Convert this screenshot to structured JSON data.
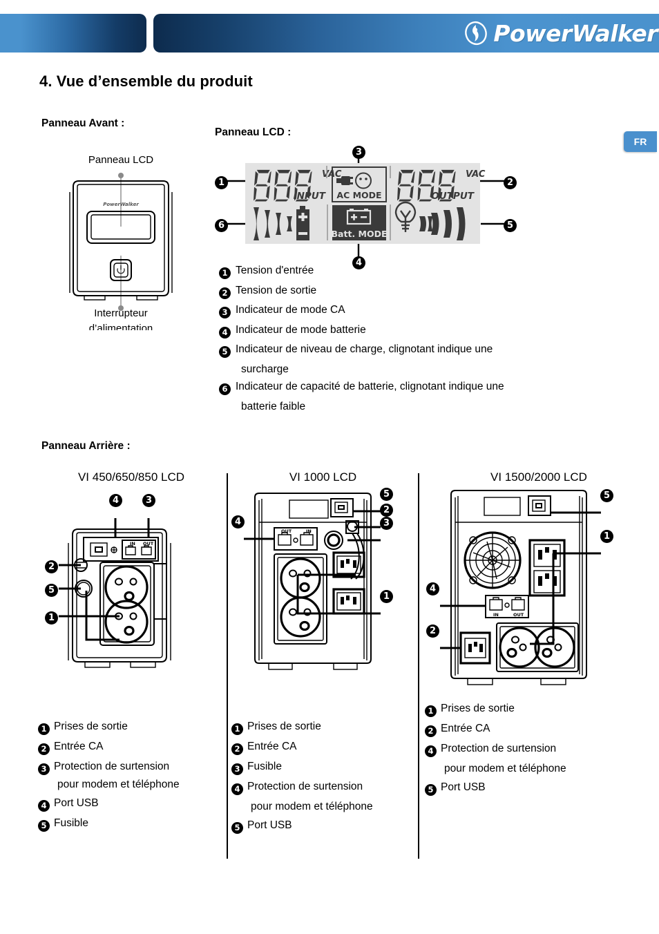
{
  "header": {
    "brand": "PowerWalker",
    "logo_icon": "powerwalker-circle-logo"
  },
  "language_tab": {
    "label": "FR"
  },
  "page": {
    "section_title": "4. Vue d’ensemble du produit"
  },
  "front_panel": {
    "heading": "Panneau Avant :",
    "callout_top": "Panneau LCD",
    "callout_bottom": "Interrupteur",
    "callout_bottom_clipped": "d’alimentation"
  },
  "lcd_panel": {
    "heading": "Panneau LCD :",
    "display": {
      "input_digits": "888",
      "input_unit": "VAC",
      "input_label": "INPUT",
      "output_digits": "888",
      "output_unit": "VAC",
      "output_label": "OUTPUT",
      "ac_mode_label": "AC MODE",
      "batt_mode_label": "Batt. MODE"
    },
    "callouts": [
      "1",
      "2",
      "3",
      "4",
      "5",
      "6"
    ],
    "legend": [
      {
        "num": "1",
        "text": "Tension d'entrée"
      },
      {
        "num": "2",
        "text": "Tension de sortie"
      },
      {
        "num": "3",
        "text": "Indicateur de mode CA"
      },
      {
        "num": "4",
        "text": "Indicateur de mode batterie"
      },
      {
        "num": "5",
        "text": "Indicateur de niveau de charge, clignotant indique une",
        "cont": "surcharge"
      },
      {
        "num": "6",
        "text": "Indicateur de capacité de batterie, clignotant indique une",
        "cont": "batterie faible"
      }
    ]
  },
  "rear_panel": {
    "heading": "Panneau Arrière :",
    "columns": [
      {
        "title": "VI 450/650/850 LCD",
        "diagram_callouts": [
          "1",
          "2",
          "3",
          "4",
          "5"
        ],
        "legend": [
          {
            "num": "1",
            "text": "Prises de sortie"
          },
          {
            "num": "2",
            "text": "Entrée CA"
          },
          {
            "num": "3",
            "text": "Protection de surtension",
            "cont": "pour modem et téléphone"
          },
          {
            "num": "4",
            "text": "Port USB"
          },
          {
            "num": "5",
            "text": "Fusible"
          }
        ]
      },
      {
        "title": "VI 1000 LCD",
        "diagram_callouts": [
          "1",
          "2",
          "3",
          "4",
          "5"
        ],
        "legend": [
          {
            "num": "1",
            "text": "Prises de sortie"
          },
          {
            "num": "2",
            "text": "Entrée CA"
          },
          {
            "num": "3",
            "text": "Fusible"
          },
          {
            "num": "4",
            "text": "Protection de surtension",
            "cont": "pour modem et téléphone"
          },
          {
            "num": "5",
            "text": "Port USB"
          }
        ]
      },
      {
        "title": "VI 1500/2000 LCD",
        "diagram_callouts": [
          "1",
          "2",
          "4",
          "5"
        ],
        "legend": [
          {
            "num": "1",
            "text": "Prises de sortie"
          },
          {
            "num": "2",
            "text": "Entrée CA"
          },
          {
            "num": "4",
            "text": "Protection de surtension",
            "cont": "pour modem et téléphone"
          },
          {
            "num": "5",
            "text": "Port USB"
          }
        ]
      }
    ]
  },
  "rear_diagram_labels": {
    "in": "IN",
    "out": "OUT"
  },
  "colors": {
    "header_light_blue": "#4a92cd",
    "header_dark_navy": "#0d2b4d",
    "tab_blue": "#4a90cd",
    "lcd_background": "#e3e3e3",
    "ink": "#000000"
  }
}
